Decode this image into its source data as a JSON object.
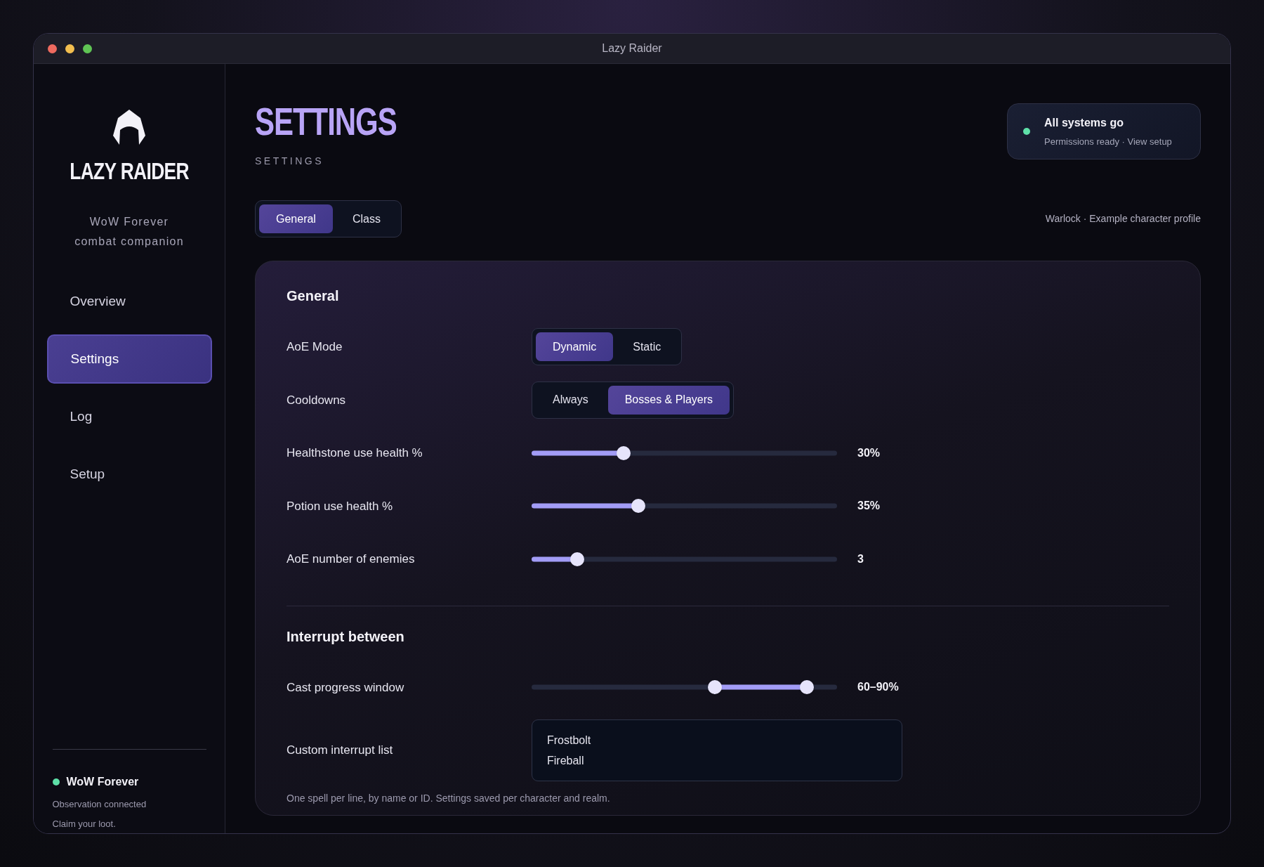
{
  "window": {
    "title": "Lazy Raider"
  },
  "sidebar": {
    "brand": "LAZY RAIDER",
    "tagline": [
      "WoW Forever",
      "combat companion"
    ],
    "nav": [
      {
        "label": "Overview",
        "selected": false
      },
      {
        "label": "Settings",
        "selected": true
      },
      {
        "label": "Log",
        "selected": false
      },
      {
        "label": "Setup",
        "selected": false
      }
    ],
    "footer": {
      "title": "WoW Forever",
      "lines": [
        "Observation connected",
        "Claim your loot."
      ]
    }
  },
  "header": {
    "title": "SETTINGS",
    "subtitle": "SETTINGS"
  },
  "status": {
    "title": "All systems go",
    "detail": "Permissions ready · View setup"
  },
  "tabs": [
    {
      "label": "General",
      "selected": true
    },
    {
      "label": "Class",
      "selected": false
    }
  ],
  "profile": "Warlock · Example character profile",
  "sections": [
    {
      "heading": "General",
      "rows": [
        {
          "kind": "choice",
          "label": "AoE Mode",
          "options": [
            {
              "label": "Dynamic",
              "selected": true
            },
            {
              "label": "Static",
              "selected": false
            }
          ]
        },
        {
          "kind": "choice",
          "label": "Cooldowns",
          "options": [
            {
              "label": "Always",
              "selected": false
            },
            {
              "label": "Bosses & Players",
              "selected": true
            }
          ]
        },
        {
          "kind": "slider",
          "label": "Healthstone use health %",
          "level": 0.3,
          "reading": "30%"
        },
        {
          "kind": "slider",
          "label": "Potion use health %",
          "level": 0.35,
          "reading": "35%"
        },
        {
          "kind": "slider",
          "label": "AoE number of enemies",
          "level": 0.15,
          "reading": "3"
        }
      ]
    },
    {
      "heading": "Interrupt between",
      "rows": [
        {
          "kind": "range",
          "label": "Cast progress window",
          "thumbs": [
            {
              "level": 0.6
            },
            {
              "level": 0.9
            }
          ],
          "reading": "60–90%"
        },
        {
          "kind": "list",
          "label": "Custom interrupt list",
          "lines": [
            "Frostbolt",
            "Fireball"
          ]
        }
      ]
    }
  ],
  "note": "One spell per line, by name or ID. Settings saved per character and realm."
}
